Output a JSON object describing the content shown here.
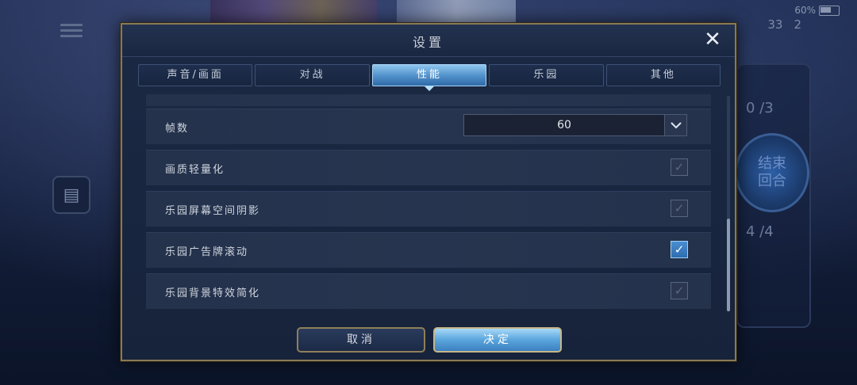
{
  "status": {
    "battery": "60%",
    "stat_1": "33",
    "stat_2": "2"
  },
  "side": {
    "turn_end_line1": "结束",
    "turn_end_line2": "回合",
    "score_top": "0 /3",
    "score_bottom": "4 /4"
  },
  "dialog": {
    "title": "设置",
    "close": "✕",
    "tabs": [
      {
        "label": "声音/画面",
        "active": false
      },
      {
        "label": "对战",
        "active": false
      },
      {
        "label": "性能",
        "active": true
      },
      {
        "label": "乐园",
        "active": false
      },
      {
        "label": "其他",
        "active": false
      }
    ],
    "settings": {
      "fps_label": "帧数",
      "fps_value": "60",
      "rows": [
        {
          "label": "画质轻量化",
          "checked": true,
          "enabled": false
        },
        {
          "label": "乐园屏幕空间阴影",
          "checked": true,
          "enabled": false
        },
        {
          "label": "乐园广告牌滚动",
          "checked": true,
          "enabled": true
        },
        {
          "label": "乐园背景特效简化",
          "checked": true,
          "enabled": false
        }
      ]
    },
    "buttons": {
      "cancel": "取消",
      "confirm": "决定"
    }
  },
  "icons": {
    "menu": "hamburger-icon",
    "document": "document-icon",
    "close": "close-icon",
    "dropdown": "chevron-down-icon",
    "check": "checkmark-icon"
  },
  "colors": {
    "accent": "#4f8fc8",
    "frame_gold": "#8a7a55"
  }
}
